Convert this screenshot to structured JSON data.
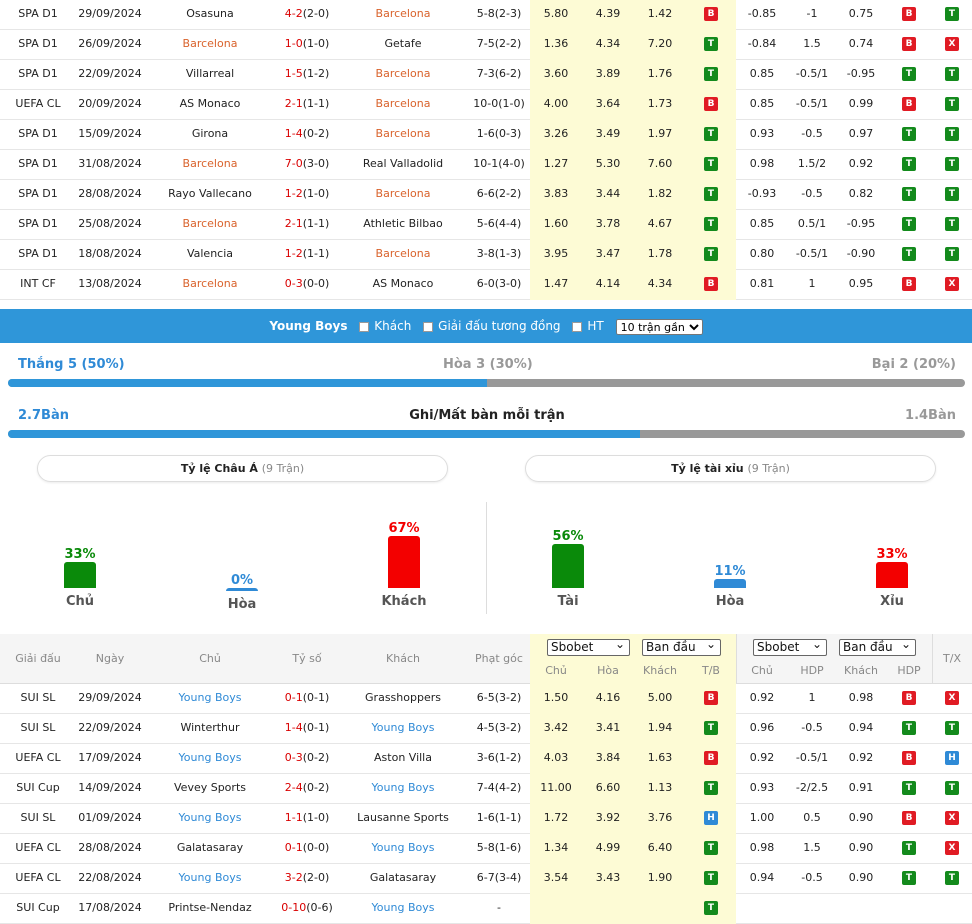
{
  "top_rows": [
    {
      "league": "SPA D1",
      "date": "29/09/2024",
      "home": "Osasuna",
      "home_hl": false,
      "score": "4-2",
      "ht": "(2-0)",
      "away": "Barcelona",
      "away_hl": true,
      "corner": "5-8(2-3)",
      "o1": "5.80",
      "o2": "4.39",
      "o3": "1.42",
      "tb": "B",
      "h1": "-0.85",
      "hdp": "-1",
      "h2": "0.75",
      "r1": "B",
      "r2": "T"
    },
    {
      "league": "SPA D1",
      "date": "26/09/2024",
      "home": "Barcelona",
      "home_hl": true,
      "score": "1-0",
      "ht": "(1-0)",
      "away": "Getafe",
      "away_hl": false,
      "corner": "7-5(2-2)",
      "o1": "1.36",
      "o2": "4.34",
      "o3": "7.20",
      "tb": "T",
      "h1": "-0.84",
      "hdp": "1.5",
      "h2": "0.74",
      "r1": "B",
      "r2": "X"
    },
    {
      "league": "SPA D1",
      "date": "22/09/2024",
      "home": "Villarreal",
      "home_hl": false,
      "score": "1-5",
      "ht": "(1-2)",
      "away": "Barcelona",
      "away_hl": true,
      "corner": "7-3(6-2)",
      "o1": "3.60",
      "o2": "3.89",
      "o3": "1.76",
      "tb": "T",
      "h1": "0.85",
      "hdp": "-0.5/1",
      "h2": "-0.95",
      "r1": "T",
      "r2": "T"
    },
    {
      "league": "UEFA CL",
      "date": "20/09/2024",
      "home": "AS Monaco",
      "home_hl": false,
      "score": "2-1",
      "ht": "(1-1)",
      "away": "Barcelona",
      "away_hl": true,
      "corner": "10-0(1-0)",
      "o1": "4.00",
      "o2": "3.64",
      "o3": "1.73",
      "tb": "B",
      "h1": "0.85",
      "hdp": "-0.5/1",
      "h2": "0.99",
      "r1": "B",
      "r2": "T"
    },
    {
      "league": "SPA D1",
      "date": "15/09/2024",
      "home": "Girona",
      "home_hl": false,
      "score": "1-4",
      "ht": "(0-2)",
      "away": "Barcelona",
      "away_hl": true,
      "corner": "1-6(0-3)",
      "o1": "3.26",
      "o2": "3.49",
      "o3": "1.97",
      "tb": "T",
      "h1": "0.93",
      "hdp": "-0.5",
      "h2": "0.97",
      "r1": "T",
      "r2": "T"
    },
    {
      "league": "SPA D1",
      "date": "31/08/2024",
      "home": "Barcelona",
      "home_hl": true,
      "score": "7-0",
      "ht": "(3-0)",
      "away": "Real Valladolid",
      "away_hl": false,
      "corner": "10-1(4-0)",
      "o1": "1.27",
      "o2": "5.30",
      "o3": "7.60",
      "tb": "T",
      "h1": "0.98",
      "hdp": "1.5/2",
      "h2": "0.92",
      "r1": "T",
      "r2": "T"
    },
    {
      "league": "SPA D1",
      "date": "28/08/2024",
      "home": "Rayo Vallecano",
      "home_hl": false,
      "score": "1-2",
      "ht": "(1-0)",
      "away": "Barcelona",
      "away_hl": true,
      "corner": "6-6(2-2)",
      "o1": "3.83",
      "o2": "3.44",
      "o3": "1.82",
      "tb": "T",
      "h1": "-0.93",
      "hdp": "-0.5",
      "h2": "0.82",
      "r1": "T",
      "r2": "T"
    },
    {
      "league": "SPA D1",
      "date": "25/08/2024",
      "home": "Barcelona",
      "home_hl": true,
      "score": "2-1",
      "ht": "(1-1)",
      "away": "Athletic Bilbao",
      "away_hl": false,
      "corner": "5-6(4-4)",
      "o1": "1.60",
      "o2": "3.78",
      "o3": "4.67",
      "tb": "T",
      "h1": "0.85",
      "hdp": "0.5/1",
      "h2": "-0.95",
      "r1": "T",
      "r2": "T"
    },
    {
      "league": "SPA D1",
      "date": "18/08/2024",
      "home": "Valencia",
      "home_hl": false,
      "score": "1-2",
      "ht": "(1-1)",
      "away": "Barcelona",
      "away_hl": true,
      "corner": "3-8(1-3)",
      "o1": "3.95",
      "o2": "3.47",
      "o3": "1.78",
      "tb": "T",
      "h1": "0.80",
      "hdp": "-0.5/1",
      "h2": "-0.90",
      "r1": "T",
      "r2": "T"
    },
    {
      "league": "INT CF",
      "date": "13/08/2024",
      "home": "Barcelona",
      "home_hl": true,
      "score": "0-3",
      "ht": "(0-0)",
      "away": "AS Monaco",
      "away_hl": false,
      "corner": "6-0(3-0)",
      "o1": "1.47",
      "o2": "4.14",
      "o3": "4.34",
      "tb": "B",
      "h1": "0.81",
      "hdp": "1",
      "h2": "0.95",
      "r1": "B",
      "r2": "X"
    }
  ],
  "filter": {
    "team": "Young Boys",
    "away_label": "Khách",
    "same_league_label": "Giải đấu tương đồng",
    "ht_label": "HT",
    "select_value": "10 trận gần"
  },
  "summary": {
    "win": "Thắng 5 (50%)",
    "draw": "Hòa 3 (30%)",
    "loss": "Bại 2 (20%)",
    "win_fraction": 0.5,
    "goals_for": "2.7Bàn",
    "goals_title": "Ghi/Mất bàn mỗi trận",
    "goals_against": "1.4Bàn",
    "goals_fraction": 0.66
  },
  "asian": {
    "title": "Tỷ lệ Châu Á",
    "sub": "(9 Trận)",
    "cols": [
      {
        "pct": "33%",
        "label": "Chủ",
        "value": 33,
        "color": "#0a8a0a"
      },
      {
        "pct": "0%",
        "label": "Hòa",
        "value": 0,
        "color": "#2f8ad6"
      },
      {
        "pct": "67%",
        "label": "Khách",
        "value": 67,
        "color": "#f30000"
      }
    ]
  },
  "ou": {
    "title": "Tỷ lệ tài xỉu",
    "sub": "(9 Trận)",
    "cols": [
      {
        "pct": "56%",
        "label": "Tài",
        "value": 56,
        "color": "#0a8a0a"
      },
      {
        "pct": "11%",
        "label": "Hòa",
        "value": 11,
        "color": "#2f8ad6"
      },
      {
        "pct": "33%",
        "label": "Xỉu",
        "value": 33,
        "color": "#f30000"
      }
    ]
  },
  "header": {
    "league": "Giải đấu",
    "date": "Ngày",
    "home": "Chủ",
    "score": "Tỷ số",
    "away": "Khách",
    "corner": "Phạt góc",
    "sel1": "Sbobet",
    "sel2": "Ban đầu",
    "sel3": "Sbobet",
    "sel4": "Ban đầu",
    "o1": "Chủ",
    "o2": "Hòa",
    "o3": "Khách",
    "tb": "T/B",
    "h1": "Chủ",
    "hdp": "HDP",
    "h2": "Khách",
    "hdp2": "HDP",
    "tx": "T/X"
  },
  "bottom_rows": [
    {
      "league": "SUI SL",
      "date": "29/09/2024",
      "home": "Young Boys",
      "home_hl": true,
      "score": "0-1",
      "ht": "(0-1)",
      "away": "Grasshoppers",
      "away_hl": false,
      "corner": "6-5(3-2)",
      "o1": "1.50",
      "o2": "4.16",
      "o3": "5.00",
      "tb": "B",
      "h1": "0.92",
      "hdp": "1",
      "h2": "0.98",
      "r1": "B",
      "r2": "X"
    },
    {
      "league": "SUI SL",
      "date": "22/09/2024",
      "home": "Winterthur",
      "home_hl": false,
      "score": "1-4",
      "ht": "(0-1)",
      "away": "Young Boys",
      "away_hl": true,
      "corner": "4-5(3-2)",
      "o1": "3.42",
      "o2": "3.41",
      "o3": "1.94",
      "tb": "T",
      "h1": "0.96",
      "hdp": "-0.5",
      "h2": "0.94",
      "r1": "T",
      "r2": "T"
    },
    {
      "league": "UEFA CL",
      "date": "17/09/2024",
      "home": "Young Boys",
      "home_hl": true,
      "score": "0-3",
      "ht": "(0-2)",
      "away": "Aston Villa",
      "away_hl": false,
      "corner": "3-6(1-2)",
      "o1": "4.03",
      "o2": "3.84",
      "o3": "1.63",
      "tb": "B",
      "h1": "0.92",
      "hdp": "-0.5/1",
      "h2": "0.92",
      "r1": "B",
      "r2": "H"
    },
    {
      "league": "SUI Cup",
      "date": "14/09/2024",
      "home": "Vevey Sports",
      "home_hl": false,
      "score": "2-4",
      "ht": "(0-2)",
      "away": "Young Boys",
      "away_hl": true,
      "corner": "7-4(4-2)",
      "o1": "11.00",
      "o2": "6.60",
      "o3": "1.13",
      "tb": "T",
      "h1": "0.93",
      "hdp": "-2/2.5",
      "h2": "0.91",
      "r1": "T",
      "r2": "T"
    },
    {
      "league": "SUI SL",
      "date": "01/09/2024",
      "home": "Young Boys",
      "home_hl": true,
      "score": "1-1",
      "ht": "(1-0)",
      "away": "Lausanne Sports",
      "away_hl": false,
      "corner": "1-6(1-1)",
      "o1": "1.72",
      "o2": "3.92",
      "o3": "3.76",
      "tb": "H",
      "h1": "1.00",
      "hdp": "0.5",
      "h2": "0.90",
      "r1": "B",
      "r2": "X"
    },
    {
      "league": "UEFA CL",
      "date": "28/08/2024",
      "home": "Galatasaray",
      "home_hl": false,
      "score": "0-1",
      "ht": "(0-0)",
      "away": "Young Boys",
      "away_hl": true,
      "corner": "5-8(1-6)",
      "o1": "1.34",
      "o2": "4.99",
      "o3": "6.40",
      "tb": "T",
      "h1": "0.98",
      "hdp": "1.5",
      "h2": "0.90",
      "r1": "T",
      "r2": "X"
    },
    {
      "league": "UEFA CL",
      "date": "22/08/2024",
      "home": "Young Boys",
      "home_hl": true,
      "score": "3-2",
      "ht": "(2-0)",
      "away": "Galatasaray",
      "away_hl": false,
      "corner": "6-7(3-4)",
      "o1": "3.54",
      "o2": "3.43",
      "o3": "1.90",
      "tb": "T",
      "h1": "0.94",
      "hdp": "-0.5",
      "h2": "0.90",
      "r1": "T",
      "r2": "T"
    },
    {
      "league": "SUI Cup",
      "date": "17/08/2024",
      "home": "Printse-Nendaz",
      "home_hl": false,
      "score": "0-10",
      "ht": "(0-6)",
      "away": "Young Boys",
      "away_hl": true,
      "corner": "-",
      "o1": "",
      "o2": "",
      "o3": "",
      "tb": "T",
      "h1": "",
      "hdp": "",
      "h2": "",
      "r1": "",
      "r2": ""
    }
  ]
}
